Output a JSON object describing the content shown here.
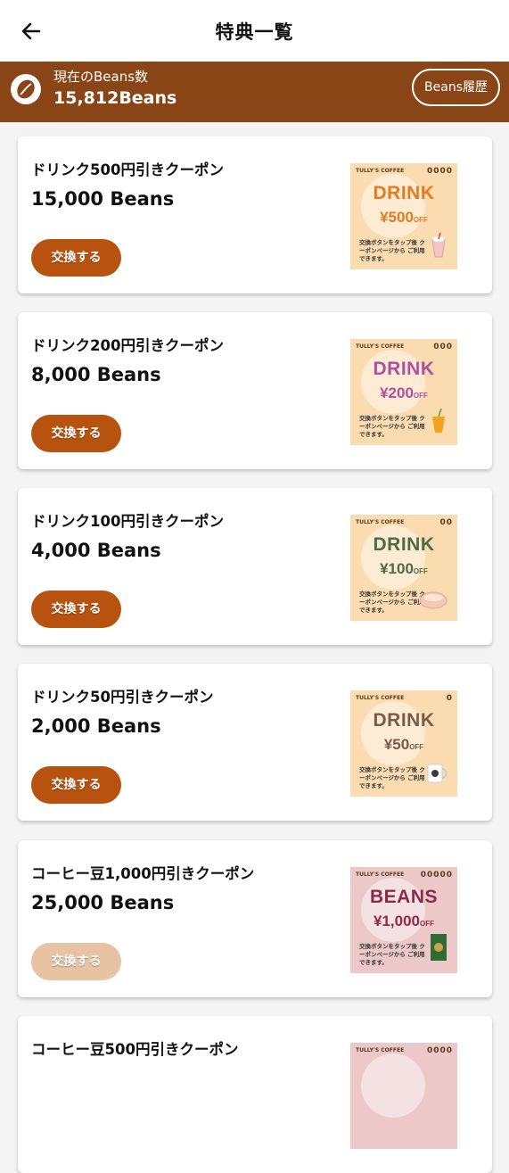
{
  "header": {
    "title": "特典一覧"
  },
  "beans": {
    "label": "現在のBeans数",
    "count": "15,812Beans",
    "history_button": "Beans履歴"
  },
  "colors": {
    "brand": "#8a4517",
    "button_active": "#b8520f",
    "button_disabled": "#e8c3a3"
  },
  "coupons": [
    {
      "title": "ドリンク500円引きクーポン",
      "price": "15,000 Beans",
      "button": "交換する",
      "enabled": true,
      "thumb": {
        "brand": "TULLY'S COFFEE",
        "marks": "0000",
        "word": "DRINK",
        "amount": "¥500",
        "off": "OFF",
        "note": "交換ボタンをタップ後 クーポンページから ご利用できます。",
        "color": "#e67a1e",
        "bg": "#fbdcb0",
        "icon": "drink-cup-icon"
      }
    },
    {
      "title": "ドリンク200円引きクーポン",
      "price": "8,000 Beans",
      "button": "交換する",
      "enabled": true,
      "thumb": {
        "brand": "TULLY'S COFFEE",
        "marks": "000",
        "word": "DRINK",
        "amount": "¥200",
        "off": "OFF",
        "note": "交換ボタンをタップ後 クーポンページから ご利用できます。",
        "color": "#b04f9e",
        "bg": "#fbdcb0",
        "icon": "juice-cup-icon"
      }
    },
    {
      "title": "ドリンク100円引きクーポン",
      "price": "4,000 Beans",
      "button": "交換する",
      "enabled": true,
      "thumb": {
        "brand": "TULLY'S COFFEE",
        "marks": "00",
        "word": "DRINK",
        "amount": "¥100",
        "off": "OFF",
        "note": "交換ボタンをタップ後 クーポンページから ご利用できます。",
        "color": "#4d6b44",
        "bg": "#fbdcb0",
        "icon": "latte-cup-icon"
      }
    },
    {
      "title": "ドリンク50円引きクーポン",
      "price": "2,000 Beans",
      "button": "交換する",
      "enabled": true,
      "thumb": {
        "brand": "TULLY'S COFFEE",
        "marks": "0",
        "word": "DRINK",
        "amount": "¥50",
        "off": "OFF",
        "note": "交換ボタンをタップ後 クーポンページから ご利用できます。",
        "color": "#7a5a4a",
        "bg": "#fbdcb0",
        "icon": "mug-icon"
      }
    },
    {
      "title": "コーヒー豆1,000円引きクーポン",
      "price": "25,000 Beans",
      "button": "交換する",
      "enabled": false,
      "thumb": {
        "brand": "TULLY'S COFFEE",
        "marks": "00000",
        "word": "BEANS",
        "amount": "¥1,000",
        "off": "OFF",
        "note": "交換ボタンをタップ後 クーポンページから ご利用できます。",
        "color": "#8b2b4a",
        "bg": "#ecc9c8",
        "icon": "coffee-bag-icon"
      }
    },
    {
      "title": "コーヒー豆500円引きクーポン",
      "price": "",
      "button": "",
      "enabled": false,
      "thumb": {
        "brand": "TULLY'S COFFEE",
        "marks": "0000",
        "word": "",
        "amount": "",
        "off": "",
        "note": "",
        "color": "#8b2b4a",
        "bg": "#ecc9c8",
        "icon": "coffee-bag-icon"
      }
    }
  ]
}
